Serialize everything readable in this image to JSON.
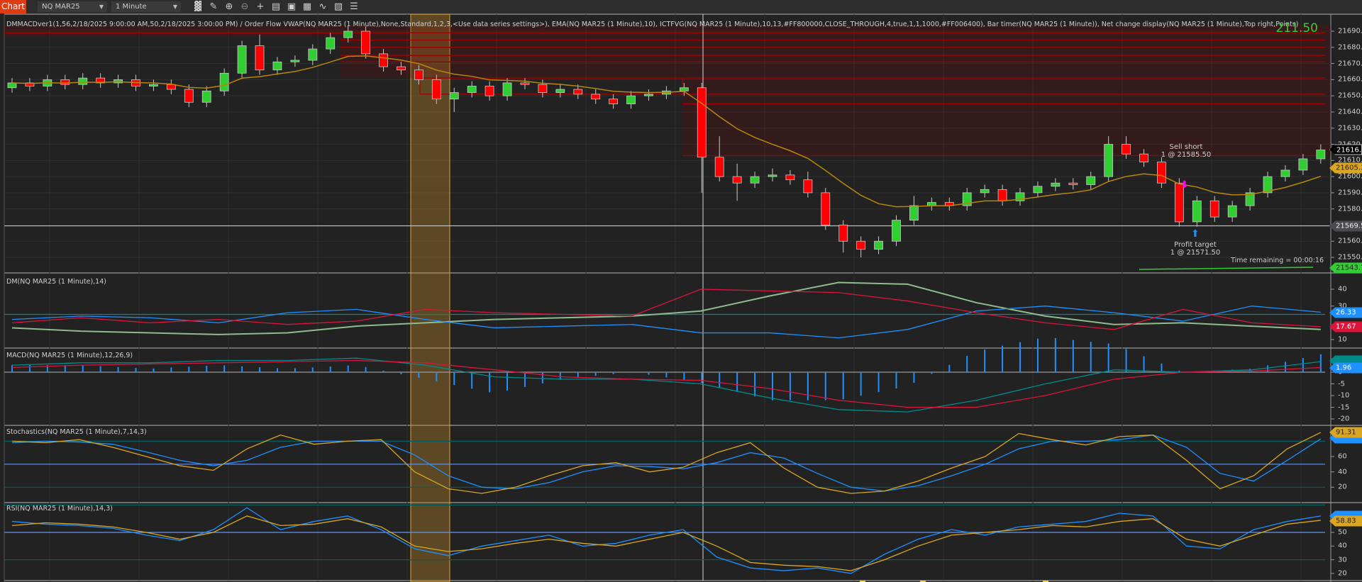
{
  "toolbar": {
    "chart_label": "Chart",
    "instrument": "NQ MAR25",
    "interval": "1 Minute",
    "icons": [
      "bar-type-icon",
      "pencil-icon",
      "zoom-in-icon",
      "zoom-out-icon",
      "crosshair-icon",
      "data-box-icon",
      "properties-icon",
      "indicators-icon",
      "strategies-icon",
      "templates-icon",
      "list-icon"
    ]
  },
  "price_panel": {
    "label": "DMMACDver1(1,56,2/18/2025 9:00:00 AM,50,2/18/2025 3:00:00 PM) / Order Flow VWAP(NQ MAR25 (1 Minute),None,Standard,1,2,3,<Use data series settings>), EMA(NQ MAR25 (1 Minute),10), ICTFVG(NQ MAR25 (1 Minute),10,13,#FF800000,CLOSE_THROUGH,4,true,1,1,1000,#FF006400), Bar timer(NQ MAR25 (1 Minute)), Net change display(NQ MAR25 (1 Minute),Top right,Points)",
    "net_change": "211.50",
    "time_remaining": "Time remaining = 00:00:16",
    "ticks": [
      "21690.00",
      "21680.00",
      "21670.00",
      "21660.00",
      "21650.00",
      "21640.00",
      "21630.00",
      "21620.00",
      "21610.00",
      "21600.00",
      "21590.00",
      "21580.00",
      "21560.00",
      "21550.00"
    ],
    "tags": {
      "last": "21616.50",
      "ema": "21605.35",
      "target_line": "21569.50",
      "vwap": "21543.73"
    },
    "sell_short": {
      "line1": "Sell short",
      "line2": "1 @ 21585.50"
    },
    "profit_target": {
      "line1": "Profit target",
      "line2": "1 @ 21571.50"
    },
    "colors": {
      "up": "#32cd32",
      "down": "#ff0000",
      "ema": "#b8860b",
      "fvg": "#8b0000",
      "highlight": "#c8902a"
    },
    "ohlc": [
      [
        21655,
        21661,
        21652,
        21658
      ],
      [
        21658,
        21661,
        21653,
        21656
      ],
      [
        21656,
        21663,
        21653,
        21660
      ],
      [
        21660,
        21663,
        21654,
        21657
      ],
      [
        21657,
        21664,
        21654,
        21661
      ],
      [
        21661,
        21664,
        21655,
        21658
      ],
      [
        21658,
        21663,
        21655,
        21660
      ],
      [
        21660,
        21663,
        21653,
        21656
      ],
      [
        21656,
        21660,
        21653,
        21657
      ],
      [
        21657,
        21660,
        21651,
        21654
      ],
      [
        21654,
        21657,
        21643,
        21646
      ],
      [
        21646,
        21656,
        21643,
        21653
      ],
      [
        21653,
        21667,
        21650,
        21664
      ],
      [
        21664,
        21684,
        21661,
        21681
      ],
      [
        21681,
        21688,
        21663,
        21666
      ],
      [
        21666,
        21674,
        21663,
        21671
      ],
      [
        21671,
        21675,
        21668,
        21672
      ],
      [
        21672,
        21682,
        21669,
        21679
      ],
      [
        21679,
        21689,
        21676,
        21686
      ],
      [
        21686,
        21693,
        21683,
        21690
      ],
      [
        21690,
        21693,
        21673,
        21676
      ],
      [
        21676,
        21679,
        21665,
        21668
      ],
      [
        21668,
        21671,
        21663,
        21666
      ],
      [
        21666,
        21669,
        21657,
        21660
      ],
      [
        21660,
        21663,
        21645,
        21648
      ],
      [
        21648,
        21655,
        21640,
        21652
      ],
      [
        21652,
        21659,
        21649,
        21656
      ],
      [
        21656,
        21659,
        21647,
        21650
      ],
      [
        21650,
        21661,
        21647,
        21658
      ],
      [
        21658,
        21661,
        21654,
        21657
      ],
      [
        21657,
        21660,
        21649,
        21652
      ],
      [
        21652,
        21657,
        21649,
        21654
      ],
      [
        21654,
        21657,
        21648,
        21651
      ],
      [
        21651,
        21654,
        21645,
        21648
      ],
      [
        21648,
        21651,
        21642,
        21645
      ],
      [
        21645,
        21653,
        21642,
        21650
      ],
      [
        21650,
        21654,
        21647,
        21651
      ],
      [
        21651,
        21656,
        21648,
        21653
      ],
      [
        21653,
        21658,
        21650,
        21655
      ],
      [
        21655,
        21658,
        21590,
        21612
      ],
      [
        21612,
        21625,
        21597,
        21600
      ],
      [
        21600,
        21608,
        21585,
        21596
      ],
      [
        21596,
        21603,
        21593,
        21600
      ],
      [
        21600,
        21605,
        21597,
        21601
      ],
      [
        21601,
        21604,
        21595,
        21598
      ],
      [
        21598,
        21603,
        21587,
        21590
      ],
      [
        21590,
        21593,
        21567,
        21570
      ],
      [
        21570,
        21573,
        21553,
        21560
      ],
      [
        21560,
        21563,
        21550,
        21555
      ],
      [
        21555,
        21563,
        21552,
        21560
      ],
      [
        21560,
        21576,
        21557,
        21573
      ],
      [
        21573,
        21588,
        21570,
        21582
      ],
      [
        21582,
        21587,
        21579,
        21584
      ],
      [
        21584,
        21587,
        21579,
        21582
      ],
      [
        21582,
        21593,
        21579,
        21590
      ],
      [
        21590,
        21595,
        21587,
        21592
      ],
      [
        21592,
        21595,
        21582,
        21585
      ],
      [
        21585,
        21593,
        21582,
        21590
      ],
      [
        21590,
        21597,
        21587,
        21594
      ],
      [
        21594,
        21599,
        21591,
        21596
      ],
      [
        21596,
        21599,
        21592,
        21595
      ],
      [
        21595,
        21603,
        21592,
        21600
      ],
      [
        21600,
        21625,
        21597,
        21620
      ],
      [
        21620,
        21625,
        21611,
        21614
      ],
      [
        21614,
        21617,
        21606,
        21609
      ],
      [
        21609,
        21612,
        21593,
        21596
      ],
      [
        21596,
        21599,
        21569,
        21572
      ],
      [
        21572,
        21588,
        21569,
        21585
      ],
      [
        21585,
        21588,
        21572,
        21575
      ],
      [
        21575,
        21585,
        21572,
        21582
      ],
      [
        21582,
        21593,
        21579,
        21590
      ],
      [
        21590,
        21603,
        21587,
        21600
      ],
      [
        21600,
        21607,
        21597,
        21604
      ],
      [
        21604,
        21614,
        21601,
        21611
      ],
      [
        21611,
        21620,
        21608,
        21616.5
      ]
    ]
  },
  "dm_panel": {
    "label": "DM(NQ MAR25 (1 Minute),14)",
    "ticks": [
      "40",
      "30",
      "10"
    ],
    "tags": {
      "plus_di": "26.33",
      "minus_di": "17.67"
    },
    "level": 25,
    "adx": [
      17,
      15,
      14,
      13,
      14,
      18,
      20,
      22,
      23,
      24,
      27,
      36,
      44,
      43,
      32,
      24,
      19,
      20,
      18,
      16
    ],
    "plus_di": [
      22,
      24,
      23,
      20,
      26,
      28,
      22,
      17,
      18,
      19,
      14,
      14,
      11,
      16,
      27,
      30,
      26,
      21,
      30,
      26.33
    ],
    "minus_di": [
      20,
      23,
      20,
      22,
      19,
      21,
      28,
      26,
      25,
      24,
      40,
      39,
      38,
      33,
      26,
      20,
      16,
      28,
      20,
      17.67
    ],
    "colors": {
      "adx": "#8fbc8f",
      "plus_di": "#1e90ff",
      "minus_di": "#dc143c",
      "level": "#008b8b"
    }
  },
  "macd_panel": {
    "label": "MACD(NQ MAR25 (1 Minute),12,26,9)",
    "ticks": [
      "0",
      "-5",
      "-10",
      "-15",
      "-20"
    ],
    "tags": {
      "diff": "1.96"
    },
    "macd": [
      3,
      4,
      4,
      5,
      5,
      6,
      3,
      -2,
      -3,
      -3,
      -5,
      -11,
      -16,
      -17,
      -12,
      -5,
      1,
      0,
      1,
      4.5
    ],
    "signal": [
      2,
      3,
      3.5,
      4,
      4.5,
      5,
      4,
      1,
      -2,
      -3,
      -3.5,
      -7,
      -12,
      -15,
      -15,
      -10,
      -3,
      0,
      0.5,
      1.96
    ],
    "colors": {
      "macd": "#008b8b",
      "signal": "#dc143c",
      "diff": "#1e90ff"
    }
  },
  "stoch_panel": {
    "label": "Stochastics(NQ MAR25 (1 Minute),7,14,3)",
    "ticks": [
      "60",
      "40",
      "20"
    ],
    "tags": {
      "k": "91.31"
    },
    "k": [
      80,
      78,
      82,
      72,
      60,
      48,
      42,
      70,
      88,
      76,
      80,
      82,
      40,
      18,
      12,
      20,
      35,
      48,
      52,
      40,
      46,
      65,
      78,
      45,
      20,
      12,
      15,
      28,
      45,
      60,
      90,
      82,
      75,
      86,
      88,
      55,
      18,
      35,
      70,
      91.31
    ],
    "d": [
      78,
      80,
      79,
      76,
      66,
      55,
      48,
      55,
      72,
      80,
      80,
      80,
      62,
      35,
      20,
      18,
      26,
      40,
      48,
      47,
      44,
      52,
      65,
      58,
      38,
      20,
      15,
      22,
      35,
      50,
      70,
      80,
      80,
      82,
      88,
      72,
      38,
      28,
      55,
      83
    ],
    "levels": [
      80,
      50,
      20
    ],
    "colors": {
      "k": "#daa520",
      "d": "#1e90ff"
    }
  },
  "rsi_panel": {
    "label": "RSI(NQ MAR25 (1 Minute),14,3)",
    "ticks": [
      "50",
      "40",
      "30",
      "20"
    ],
    "tags": {
      "rsi": "58.83"
    },
    "avg": [
      55,
      57,
      56,
      54,
      50,
      45,
      50,
      62,
      55,
      56,
      60,
      54,
      40,
      36,
      38,
      42,
      45,
      42,
      40,
      45,
      50,
      40,
      28,
      26,
      25,
      22,
      30,
      40,
      48,
      50,
      52,
      55,
      54,
      58,
      60,
      45,
      40,
      48,
      56,
      58.83
    ],
    "rsi": [
      58,
      56,
      55,
      53,
      48,
      44,
      52,
      68,
      52,
      58,
      62,
      52,
      38,
      33,
      40,
      44,
      48,
      40,
      42,
      48,
      52,
      32,
      24,
      22,
      24,
      20,
      34,
      45,
      52,
      48,
      54,
      56,
      58,
      64,
      62,
      40,
      38,
      52,
      58,
      62
    ],
    "levels": [
      70,
      50,
      30
    ],
    "colors": {
      "avg": "#daa520",
      "rsi": "#1e90ff"
    }
  }
}
